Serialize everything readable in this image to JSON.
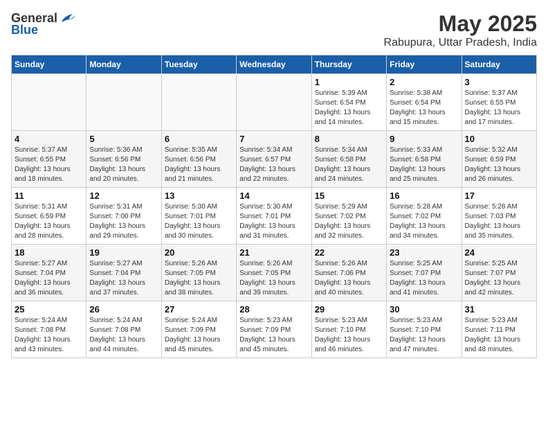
{
  "logo": {
    "general": "General",
    "blue": "Blue"
  },
  "header": {
    "title": "May 2025",
    "subtitle": "Rabupura, Uttar Pradesh, India"
  },
  "weekdays": [
    "Sunday",
    "Monday",
    "Tuesday",
    "Wednesday",
    "Thursday",
    "Friday",
    "Saturday"
  ],
  "weeks": [
    [
      {
        "day": "",
        "empty": true
      },
      {
        "day": "",
        "empty": true
      },
      {
        "day": "",
        "empty": true
      },
      {
        "day": "",
        "empty": true
      },
      {
        "day": "1",
        "sunrise": "Sunrise: 5:39 AM",
        "sunset": "Sunset: 6:54 PM",
        "daylight": "Daylight: 13 hours and 14 minutes."
      },
      {
        "day": "2",
        "sunrise": "Sunrise: 5:38 AM",
        "sunset": "Sunset: 6:54 PM",
        "daylight": "Daylight: 13 hours and 15 minutes."
      },
      {
        "day": "3",
        "sunrise": "Sunrise: 5:37 AM",
        "sunset": "Sunset: 6:55 PM",
        "daylight": "Daylight: 13 hours and 17 minutes."
      }
    ],
    [
      {
        "day": "4",
        "sunrise": "Sunrise: 5:37 AM",
        "sunset": "Sunset: 6:55 PM",
        "daylight": "Daylight: 13 hours and 18 minutes."
      },
      {
        "day": "5",
        "sunrise": "Sunrise: 5:36 AM",
        "sunset": "Sunset: 6:56 PM",
        "daylight": "Daylight: 13 hours and 20 minutes."
      },
      {
        "day": "6",
        "sunrise": "Sunrise: 5:35 AM",
        "sunset": "Sunset: 6:56 PM",
        "daylight": "Daylight: 13 hours and 21 minutes."
      },
      {
        "day": "7",
        "sunrise": "Sunrise: 5:34 AM",
        "sunset": "Sunset: 6:57 PM",
        "daylight": "Daylight: 13 hours and 22 minutes."
      },
      {
        "day": "8",
        "sunrise": "Sunrise: 5:34 AM",
        "sunset": "Sunset: 6:58 PM",
        "daylight": "Daylight: 13 hours and 24 minutes."
      },
      {
        "day": "9",
        "sunrise": "Sunrise: 5:33 AM",
        "sunset": "Sunset: 6:58 PM",
        "daylight": "Daylight: 13 hours and 25 minutes."
      },
      {
        "day": "10",
        "sunrise": "Sunrise: 5:32 AM",
        "sunset": "Sunset: 6:59 PM",
        "daylight": "Daylight: 13 hours and 26 minutes."
      }
    ],
    [
      {
        "day": "11",
        "sunrise": "Sunrise: 5:31 AM",
        "sunset": "Sunset: 6:59 PM",
        "daylight": "Daylight: 13 hours and 28 minutes."
      },
      {
        "day": "12",
        "sunrise": "Sunrise: 5:31 AM",
        "sunset": "Sunset: 7:00 PM",
        "daylight": "Daylight: 13 hours and 29 minutes."
      },
      {
        "day": "13",
        "sunrise": "Sunrise: 5:30 AM",
        "sunset": "Sunset: 7:01 PM",
        "daylight": "Daylight: 13 hours and 30 minutes."
      },
      {
        "day": "14",
        "sunrise": "Sunrise: 5:30 AM",
        "sunset": "Sunset: 7:01 PM",
        "daylight": "Daylight: 13 hours and 31 minutes."
      },
      {
        "day": "15",
        "sunrise": "Sunrise: 5:29 AM",
        "sunset": "Sunset: 7:02 PM",
        "daylight": "Daylight: 13 hours and 32 minutes."
      },
      {
        "day": "16",
        "sunrise": "Sunrise: 5:28 AM",
        "sunset": "Sunset: 7:02 PM",
        "daylight": "Daylight: 13 hours and 34 minutes."
      },
      {
        "day": "17",
        "sunrise": "Sunrise: 5:28 AM",
        "sunset": "Sunset: 7:03 PM",
        "daylight": "Daylight: 13 hours and 35 minutes."
      }
    ],
    [
      {
        "day": "18",
        "sunrise": "Sunrise: 5:27 AM",
        "sunset": "Sunset: 7:04 PM",
        "daylight": "Daylight: 13 hours and 36 minutes."
      },
      {
        "day": "19",
        "sunrise": "Sunrise: 5:27 AM",
        "sunset": "Sunset: 7:04 PM",
        "daylight": "Daylight: 13 hours and 37 minutes."
      },
      {
        "day": "20",
        "sunrise": "Sunrise: 5:26 AM",
        "sunset": "Sunset: 7:05 PM",
        "daylight": "Daylight: 13 hours and 38 minutes."
      },
      {
        "day": "21",
        "sunrise": "Sunrise: 5:26 AM",
        "sunset": "Sunset: 7:05 PM",
        "daylight": "Daylight: 13 hours and 39 minutes."
      },
      {
        "day": "22",
        "sunrise": "Sunrise: 5:26 AM",
        "sunset": "Sunset: 7:06 PM",
        "daylight": "Daylight: 13 hours and 40 minutes."
      },
      {
        "day": "23",
        "sunrise": "Sunrise: 5:25 AM",
        "sunset": "Sunset: 7:07 PM",
        "daylight": "Daylight: 13 hours and 41 minutes."
      },
      {
        "day": "24",
        "sunrise": "Sunrise: 5:25 AM",
        "sunset": "Sunset: 7:07 PM",
        "daylight": "Daylight: 13 hours and 42 minutes."
      }
    ],
    [
      {
        "day": "25",
        "sunrise": "Sunrise: 5:24 AM",
        "sunset": "Sunset: 7:08 PM",
        "daylight": "Daylight: 13 hours and 43 minutes."
      },
      {
        "day": "26",
        "sunrise": "Sunrise: 5:24 AM",
        "sunset": "Sunset: 7:08 PM",
        "daylight": "Daylight: 13 hours and 44 minutes."
      },
      {
        "day": "27",
        "sunrise": "Sunrise: 5:24 AM",
        "sunset": "Sunset: 7:09 PM",
        "daylight": "Daylight: 13 hours and 45 minutes."
      },
      {
        "day": "28",
        "sunrise": "Sunrise: 5:23 AM",
        "sunset": "Sunset: 7:09 PM",
        "daylight": "Daylight: 13 hours and 45 minutes."
      },
      {
        "day": "29",
        "sunrise": "Sunrise: 5:23 AM",
        "sunset": "Sunset: 7:10 PM",
        "daylight": "Daylight: 13 hours and 46 minutes."
      },
      {
        "day": "30",
        "sunrise": "Sunrise: 5:23 AM",
        "sunset": "Sunset: 7:10 PM",
        "daylight": "Daylight: 13 hours and 47 minutes."
      },
      {
        "day": "31",
        "sunrise": "Sunrise: 5:23 AM",
        "sunset": "Sunset: 7:11 PM",
        "daylight": "Daylight: 13 hours and 48 minutes."
      }
    ]
  ]
}
